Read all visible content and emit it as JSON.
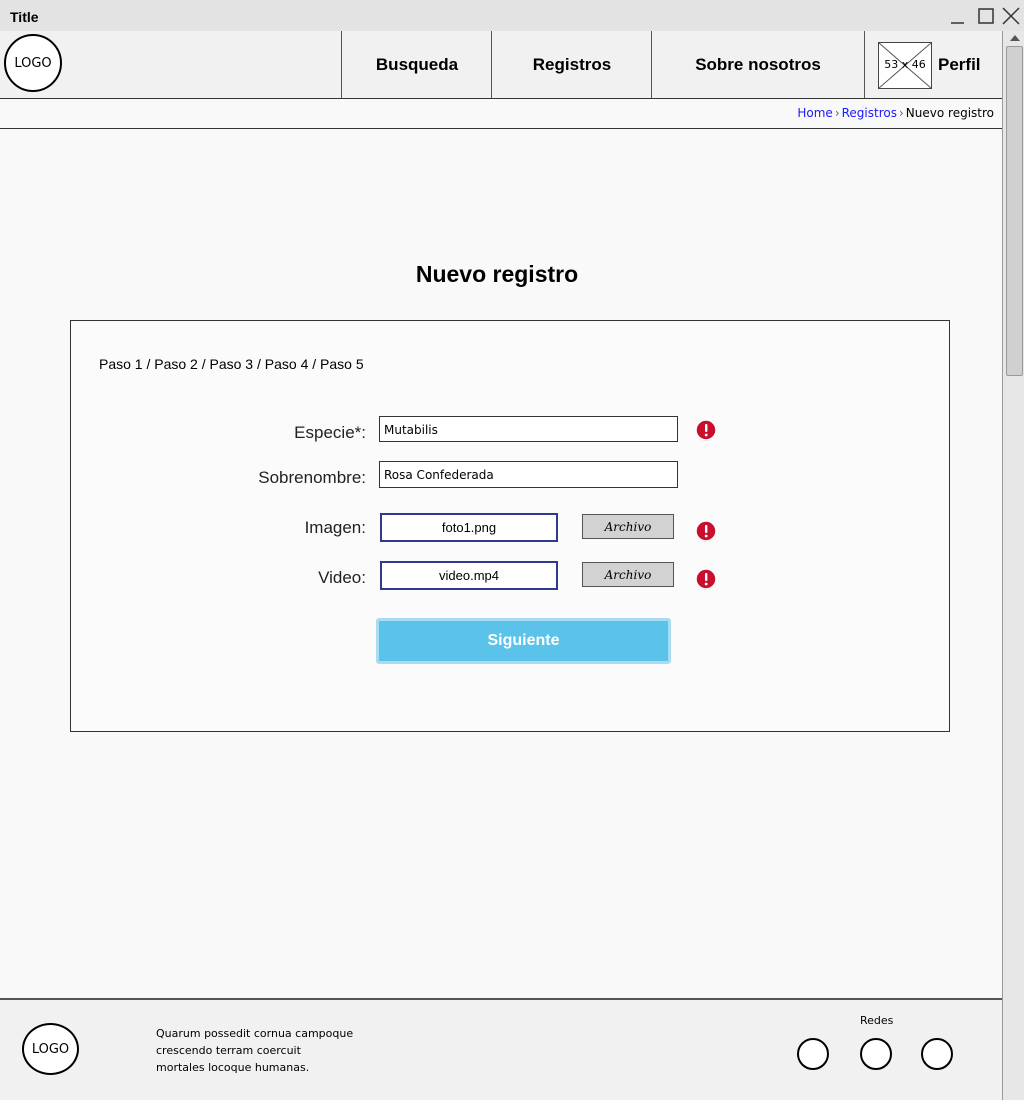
{
  "window": {
    "title": "Title"
  },
  "header": {
    "logo_text": "LOGO",
    "nav": [
      {
        "label": "Busqueda"
      },
      {
        "label": "Registros"
      },
      {
        "label": "Sobre nosotros"
      }
    ],
    "profile": {
      "image_placeholder": "53 x 46",
      "label": "Perfil"
    }
  },
  "breadcrumb": {
    "items": [
      "Home",
      "Registros",
      "Nuevo registro"
    ]
  },
  "main": {
    "title": "Nuevo registro",
    "steps": "Paso 1 / Paso 2 / Paso 3 / Paso 4 / Paso 5",
    "fields": {
      "especie": {
        "label": "Especie*:",
        "value": "Mutabilis"
      },
      "sobrenombre": {
        "label": "Sobrenombre:",
        "value": "Rosa Confederada"
      },
      "imagen": {
        "label": "Imagen:",
        "file": "foto1.png",
        "button": "Archivo"
      },
      "video": {
        "label": "Video:",
        "file": "video.mp4",
        "button": "Archivo"
      }
    },
    "submit_label": "Siguiente"
  },
  "footer": {
    "logo_text": "LOGO",
    "text_lines": [
      "Quarum possedit cornua campoque",
      "crescendo terram coercuit",
      "mortales locoque humanas."
    ],
    "social_label": "Redes"
  },
  "colors": {
    "accent": "#5bc3ea",
    "error": "#c8102e",
    "link": "#1a1aff"
  }
}
